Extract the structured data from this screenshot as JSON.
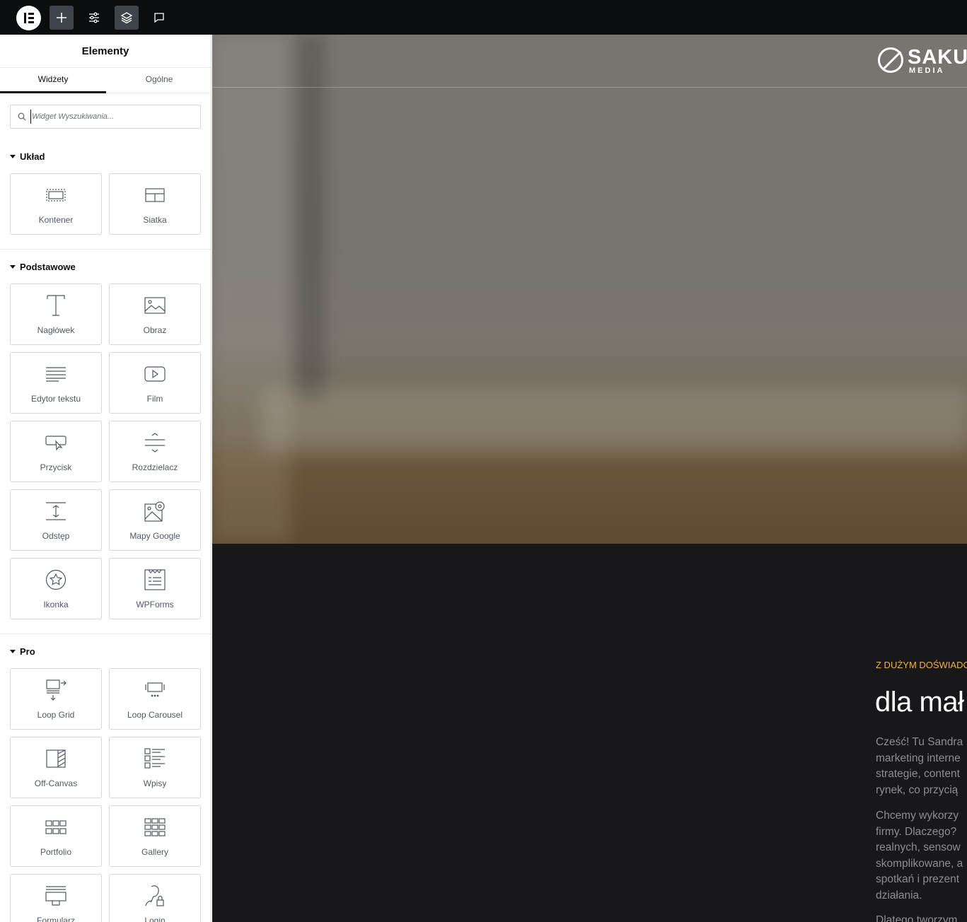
{
  "toolbar": {
    "logo": "elementor-logo",
    "buttons": [
      {
        "name": "add-element-button",
        "icon": "plus-icon"
      },
      {
        "name": "site-settings-button",
        "icon": "sliders-icon"
      },
      {
        "name": "structure-button",
        "icon": "layers-icon",
        "active": true
      },
      {
        "name": "comments-button",
        "icon": "comment-icon"
      }
    ]
  },
  "panel": {
    "title": "Elementy",
    "tabs": [
      "Widżety",
      "Ogólne"
    ],
    "search_placeholder": "Widget Wyszukiwania...",
    "categories": [
      {
        "title": "Układ",
        "widgets": [
          {
            "label": "Kontener",
            "icon": "container-icon"
          },
          {
            "label": "Siatka",
            "icon": "grid-icon"
          }
        ]
      },
      {
        "title": "Podstawowe",
        "widgets": [
          {
            "label": "Nagłówek",
            "icon": "heading-icon"
          },
          {
            "label": "Obraz",
            "icon": "image-icon"
          },
          {
            "label": "Edytor tekstu",
            "icon": "text-editor-icon"
          },
          {
            "label": "Film",
            "icon": "video-icon"
          },
          {
            "label": "Przycisk",
            "icon": "button-icon"
          },
          {
            "label": "Rozdzielacz",
            "icon": "divider-icon"
          },
          {
            "label": "Odstęp",
            "icon": "spacer-icon"
          },
          {
            "label": "Mapy Google",
            "icon": "google-maps-icon"
          },
          {
            "label": "Ikonka",
            "icon": "star-icon"
          },
          {
            "label": "WPForms",
            "icon": "wpforms-icon"
          }
        ]
      },
      {
        "title": "Pro",
        "widgets": [
          {
            "label": "Loop Grid",
            "icon": "loop-grid-icon"
          },
          {
            "label": "Loop Carousel",
            "icon": "loop-carousel-icon"
          },
          {
            "label": "Off-Canvas",
            "icon": "off-canvas-icon"
          },
          {
            "label": "Wpisy",
            "icon": "posts-icon"
          },
          {
            "label": "Portfolio",
            "icon": "portfolio-icon"
          },
          {
            "label": "Gallery",
            "icon": "gallery-icon"
          },
          {
            "label": "Formularz",
            "icon": "form-icon"
          },
          {
            "label": "Login",
            "icon": "login-icon"
          }
        ]
      }
    ]
  },
  "canvas": {
    "brand_name": "SAKU",
    "brand_sub": "MEDIA",
    "eyebrow": "Z DUŻYM DOŚWIADC",
    "headline": "dla mał",
    "paragraph1": [
      "Cześć! Tu Sandra",
      "marketing interne",
      "strategie, content",
      "rynek, co przycią"
    ],
    "paragraph2": [
      "Chcemy wykorzy",
      "firmy. Dlaczego?",
      "realnych, sensow",
      "skomplikowane, a",
      "spotkań i prezent",
      "działania."
    ],
    "paragraph3_start": "Dlatego tworzym",
    "colors": {
      "accent": "#f0b04a",
      "dark_bg": "#181719",
      "topbar": "#0c0d0e"
    }
  }
}
